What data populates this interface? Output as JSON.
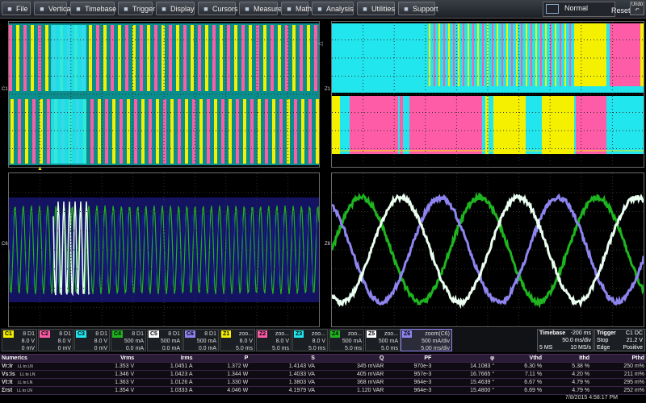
{
  "menu": [
    {
      "label": "File",
      "icon": "file-icon"
    },
    {
      "label": "Vertical",
      "icon": "vertical-icon"
    },
    {
      "label": "Timebase",
      "icon": "timebase-icon"
    },
    {
      "label": "Trigger",
      "icon": "trigger-icon"
    },
    {
      "label": "Display",
      "icon": "display-icon"
    },
    {
      "label": "Cursors",
      "icon": "cursors-icon"
    },
    {
      "label": "Measure",
      "icon": "measure-icon"
    },
    {
      "label": "Math",
      "icon": "math-icon"
    },
    {
      "label": "Analysis",
      "icon": "analysis-icon"
    },
    {
      "label": "Utilities",
      "icon": "utilities-icon"
    },
    {
      "label": "Support",
      "icon": "support-icon"
    }
  ],
  "mode_label": "Normal",
  "reset_label": "Reset",
  "undo_label": "Undo",
  "grid_labels": {
    "c1": "C1",
    "z1": "Z1",
    "c6": "C6",
    "z6": "Z6"
  },
  "colors": {
    "yellow": "#f4f000",
    "magenta": "#ff5ca8",
    "cyan": "#21e6ee",
    "green": "#1fb51f",
    "teal": "#0a8d8d",
    "navy": "#1b1b8c",
    "white": "#eafff0",
    "lavender": "#8e84f0"
  },
  "channels": [
    {
      "tag": "C1",
      "head": "8 D1",
      "v1": "8.0 V",
      "v2": "0 mV",
      "color": "#f4f000"
    },
    {
      "tag": "C2",
      "head": "8 D1",
      "v1": "8.0 V",
      "v2": "0 mV",
      "color": "#ff5ca8"
    },
    {
      "tag": "C3",
      "head": "8 D1",
      "v1": "8.0 V",
      "v2": "0 mV",
      "color": "#21e6ee"
    },
    {
      "tag": "C4",
      "head": "8 D1",
      "v1": "500 mA",
      "v2": "0.0 mA",
      "color": "#1fb51f"
    },
    {
      "tag": "C5",
      "head": "8 D1",
      "v1": "500 mA",
      "v2": "0.0 mA",
      "color": "#ffffff"
    },
    {
      "tag": "C6",
      "head": "8 D1",
      "v1": "500 mA",
      "v2": "0.0 mA",
      "color": "#8e84f0"
    },
    {
      "tag": "Z1",
      "head": "zoo...",
      "v1": "8.0 V",
      "v2": "5.0 ms",
      "color": "#f4f000"
    },
    {
      "tag": "Z2",
      "head": "zoo...",
      "v1": "8.0 V",
      "v2": "5.0 ms",
      "color": "#ff5ca8"
    },
    {
      "tag": "Z3",
      "head": "zoo...",
      "v1": "8.0 V",
      "v2": "5.0 ms",
      "color": "#21e6ee"
    },
    {
      "tag": "Z4",
      "head": "zoo...",
      "v1": "500 mA",
      "v2": "5.0 ms",
      "color": "#1fb51f"
    },
    {
      "tag": "Z5",
      "head": "zoo...",
      "v1": "500 mA",
      "v2": "5.0 ms",
      "color": "#ffffff"
    }
  ],
  "z6": {
    "tag": "Z6",
    "head": "zoom(C6)",
    "v1": "500 mA/div",
    "v2": "5.00 ms/div"
  },
  "timebase": {
    "title": "Timebase",
    "delay": "-200 ms",
    "rate": "50.0 ms/div",
    "mem": "5 MS",
    "sr": "10 MS/s"
  },
  "trigger": {
    "title": "Trigger",
    "src": "C1 DC",
    "mode": "Stop",
    "level": "21.2 V",
    "type": "Edge",
    "slope": "Positive"
  },
  "numerics": {
    "headers": [
      "Numerics",
      "Vrms",
      "Irms",
      "P",
      "S",
      "Q",
      "PF",
      "φ",
      "Vthd",
      "Ithd",
      "Pthd"
    ],
    "rows": [
      {
        "name": "Vr:Ir",
        "sub": "LL to LN",
        "vals": [
          "1.353 V",
          "1.0451 A",
          "1.372 W",
          "1.4143 VA",
          "345 mVAR",
          "970e-3",
          "14.1083 °",
          "6.30 %",
          "5.38 %",
          "250 m%"
        ]
      },
      {
        "name": "Vs:Is",
        "sub": "LL to LN",
        "vals": [
          "1.346 V",
          "1.0423 A",
          "1.344 W",
          "1.4033 VA",
          "405 mVAR",
          "957e-3",
          "16.7665 °",
          "7.11 %",
          "4.20 %",
          "211 m%"
        ]
      },
      {
        "name": "Vt:It",
        "sub": "LL to LN",
        "vals": [
          "1.363 V",
          "1.0126 A",
          "1.330 W",
          "1.3803 VA",
          "368 mVAR",
          "964e-3",
          "15.4639 °",
          "6.67 %",
          "4.79 %",
          "295 m%"
        ]
      },
      {
        "name": "Σrst",
        "sub": "LL to LN",
        "vals": [
          "1.354 V",
          "1.0333 A",
          "4.046 W",
          "4.1979 VA",
          "1.120 VAR",
          "964e-3",
          "15.4800 °",
          "6.69 %",
          "4.79 %",
          "252 m%"
        ]
      }
    ]
  },
  "datetime": "7/8/2015 4:58:17 PM"
}
